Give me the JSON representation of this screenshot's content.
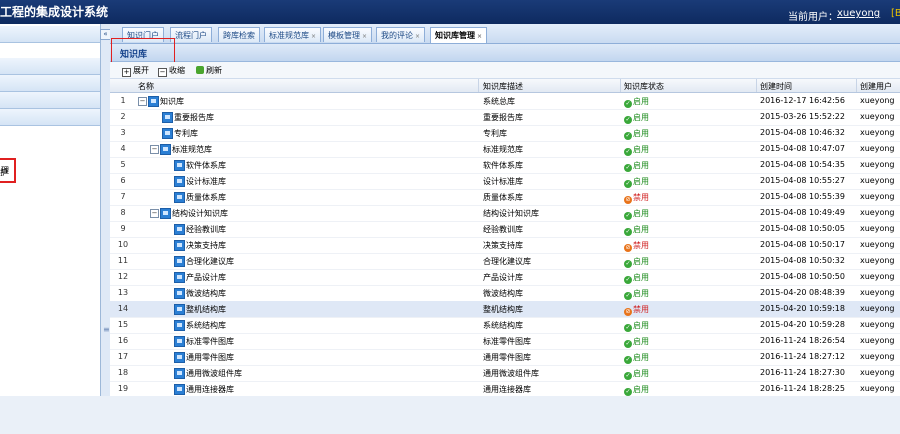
{
  "header": {
    "app_title": "工程的集成设计系统",
    "user_label": "当前用户：",
    "user_name": "xueyong",
    "user_extra": "[B"
  },
  "left_panel": {
    "item_a": "理",
    "item_b": "护"
  },
  "tabs": [
    {
      "label": "知识门户",
      "closable": false
    },
    {
      "label": "流程门户",
      "closable": false
    },
    {
      "label": "跨库检索",
      "closable": false
    },
    {
      "label": "标准规范库",
      "closable": true
    },
    {
      "label": "模板管理",
      "closable": true
    },
    {
      "label": "我的评论",
      "closable": true
    },
    {
      "label": "知识库管理",
      "closable": true,
      "active": true
    }
  ],
  "panel": {
    "title": "知识库"
  },
  "toolbar": {
    "expand": "展开",
    "collapse": "收缩",
    "refresh": "刷新"
  },
  "columns": {
    "name": "名称",
    "desc": "知识库描述",
    "status": "知识库状态",
    "time": "创建时间",
    "user": "创建用户"
  },
  "rows": [
    {
      "num": "1",
      "level": 0,
      "expander": "−",
      "name": "知识库",
      "desc": "系统总库",
      "status": "启用",
      "enabled": true,
      "time": "2016-12-17 16:42:56",
      "user": "xueyong"
    },
    {
      "num": "2",
      "level": 1,
      "expander": "",
      "name": "重要报告库",
      "desc": "重要报告库",
      "status": "启用",
      "enabled": true,
      "time": "2015-03-26 15:52:22",
      "user": "xueyong"
    },
    {
      "num": "3",
      "level": 1,
      "expander": "",
      "name": "专利库",
      "desc": "专利库",
      "status": "启用",
      "enabled": true,
      "time": "2015-04-08 10:46:32",
      "user": "xueyong"
    },
    {
      "num": "4",
      "level": 1,
      "expander": "−",
      "name": "标准规范库",
      "desc": "标准规范库",
      "status": "启用",
      "enabled": true,
      "time": "2015-04-08 10:47:07",
      "user": "xueyong"
    },
    {
      "num": "5",
      "level": 2,
      "expander": "",
      "name": "软件体系库",
      "desc": "软件体系库",
      "status": "启用",
      "enabled": true,
      "time": "2015-04-08 10:54:35",
      "user": "xueyong"
    },
    {
      "num": "6",
      "level": 2,
      "expander": "",
      "name": "设计标准库",
      "desc": "设计标准库",
      "status": "启用",
      "enabled": true,
      "time": "2015-04-08 10:55:27",
      "user": "xueyong"
    },
    {
      "num": "7",
      "level": 2,
      "expander": "",
      "name": "质量体系库",
      "desc": "质量体系库",
      "status": "禁用",
      "enabled": false,
      "time": "2015-04-08 10:55:39",
      "user": "xueyong"
    },
    {
      "num": "8",
      "level": 1,
      "expander": "−",
      "name": "结构设计知识库",
      "desc": "结构设计知识库",
      "status": "启用",
      "enabled": true,
      "time": "2015-04-08 10:49:49",
      "user": "xueyong"
    },
    {
      "num": "9",
      "level": 2,
      "expander": "",
      "name": "经验教训库",
      "desc": "经验教训库",
      "status": "启用",
      "enabled": true,
      "time": "2015-04-08 10:50:05",
      "user": "xueyong"
    },
    {
      "num": "10",
      "level": 2,
      "expander": "",
      "name": "决策支持库",
      "desc": "决策支持库",
      "status": "禁用",
      "enabled": false,
      "time": "2015-04-08 10:50:17",
      "user": "xueyong"
    },
    {
      "num": "11",
      "level": 2,
      "expander": "",
      "name": "合理化建议库",
      "desc": "合理化建议库",
      "status": "启用",
      "enabled": true,
      "time": "2015-04-08 10:50:32",
      "user": "xueyong"
    },
    {
      "num": "12",
      "level": 2,
      "expander": "",
      "name": "产品设计库",
      "desc": "产品设计库",
      "status": "启用",
      "enabled": true,
      "time": "2015-04-08 10:50:50",
      "user": "xueyong"
    },
    {
      "num": "13",
      "level": 2,
      "expander": "",
      "name": "微波结构库",
      "desc": "微波结构库",
      "status": "启用",
      "enabled": true,
      "time": "2015-04-20 08:48:39",
      "user": "xueyong"
    },
    {
      "num": "14",
      "level": 2,
      "expander": "",
      "name": "整机结构库",
      "desc": "整机结构库",
      "status": "禁用",
      "enabled": false,
      "time": "2015-04-20 10:59:18",
      "user": "xueyong",
      "selected": true
    },
    {
      "num": "15",
      "level": 2,
      "expander": "",
      "name": "系统结构库",
      "desc": "系统结构库",
      "status": "启用",
      "enabled": true,
      "time": "2015-04-20 10:59:28",
      "user": "xueyong"
    },
    {
      "num": "16",
      "level": 2,
      "expander": "",
      "name": "标准零件图库",
      "desc": "标准零件图库",
      "status": "启用",
      "enabled": true,
      "time": "2016-11-24 18:26:54",
      "user": "xueyong"
    },
    {
      "num": "17",
      "level": 2,
      "expander": "",
      "name": "通用零件图库",
      "desc": "通用零件图库",
      "status": "启用",
      "enabled": true,
      "time": "2016-11-24 18:27:12",
      "user": "xueyong"
    },
    {
      "num": "18",
      "level": 2,
      "expander": "",
      "name": "通用微波组件库",
      "desc": "通用微波组件库",
      "status": "启用",
      "enabled": true,
      "time": "2016-11-24 18:27:30",
      "user": "xueyong"
    },
    {
      "num": "19",
      "level": 2,
      "expander": "",
      "name": "通用连接器库",
      "desc": "通用连接器库",
      "status": "启用",
      "enabled": true,
      "time": "2016-11-24 18:28:25",
      "user": "xueyong"
    }
  ]
}
